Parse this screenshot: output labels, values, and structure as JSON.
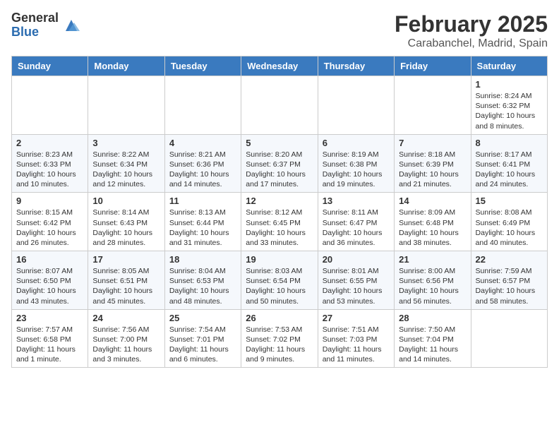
{
  "header": {
    "logo_general": "General",
    "logo_blue": "Blue",
    "month": "February 2025",
    "location": "Carabanchel, Madrid, Spain"
  },
  "days_of_week": [
    "Sunday",
    "Monday",
    "Tuesday",
    "Wednesday",
    "Thursday",
    "Friday",
    "Saturday"
  ],
  "weeks": [
    [
      {
        "day": "",
        "info": ""
      },
      {
        "day": "",
        "info": ""
      },
      {
        "day": "",
        "info": ""
      },
      {
        "day": "",
        "info": ""
      },
      {
        "day": "",
        "info": ""
      },
      {
        "day": "",
        "info": ""
      },
      {
        "day": "1",
        "info": "Sunrise: 8:24 AM\nSunset: 6:32 PM\nDaylight: 10 hours and 8 minutes."
      }
    ],
    [
      {
        "day": "2",
        "info": "Sunrise: 8:23 AM\nSunset: 6:33 PM\nDaylight: 10 hours and 10 minutes."
      },
      {
        "day": "3",
        "info": "Sunrise: 8:22 AM\nSunset: 6:34 PM\nDaylight: 10 hours and 12 minutes."
      },
      {
        "day": "4",
        "info": "Sunrise: 8:21 AM\nSunset: 6:36 PM\nDaylight: 10 hours and 14 minutes."
      },
      {
        "day": "5",
        "info": "Sunrise: 8:20 AM\nSunset: 6:37 PM\nDaylight: 10 hours and 17 minutes."
      },
      {
        "day": "6",
        "info": "Sunrise: 8:19 AM\nSunset: 6:38 PM\nDaylight: 10 hours and 19 minutes."
      },
      {
        "day": "7",
        "info": "Sunrise: 8:18 AM\nSunset: 6:39 PM\nDaylight: 10 hours and 21 minutes."
      },
      {
        "day": "8",
        "info": "Sunrise: 8:17 AM\nSunset: 6:41 PM\nDaylight: 10 hours and 24 minutes."
      }
    ],
    [
      {
        "day": "9",
        "info": "Sunrise: 8:15 AM\nSunset: 6:42 PM\nDaylight: 10 hours and 26 minutes."
      },
      {
        "day": "10",
        "info": "Sunrise: 8:14 AM\nSunset: 6:43 PM\nDaylight: 10 hours and 28 minutes."
      },
      {
        "day": "11",
        "info": "Sunrise: 8:13 AM\nSunset: 6:44 PM\nDaylight: 10 hours and 31 minutes."
      },
      {
        "day": "12",
        "info": "Sunrise: 8:12 AM\nSunset: 6:45 PM\nDaylight: 10 hours and 33 minutes."
      },
      {
        "day": "13",
        "info": "Sunrise: 8:11 AM\nSunset: 6:47 PM\nDaylight: 10 hours and 36 minutes."
      },
      {
        "day": "14",
        "info": "Sunrise: 8:09 AM\nSunset: 6:48 PM\nDaylight: 10 hours and 38 minutes."
      },
      {
        "day": "15",
        "info": "Sunrise: 8:08 AM\nSunset: 6:49 PM\nDaylight: 10 hours and 40 minutes."
      }
    ],
    [
      {
        "day": "16",
        "info": "Sunrise: 8:07 AM\nSunset: 6:50 PM\nDaylight: 10 hours and 43 minutes."
      },
      {
        "day": "17",
        "info": "Sunrise: 8:05 AM\nSunset: 6:51 PM\nDaylight: 10 hours and 45 minutes."
      },
      {
        "day": "18",
        "info": "Sunrise: 8:04 AM\nSunset: 6:53 PM\nDaylight: 10 hours and 48 minutes."
      },
      {
        "day": "19",
        "info": "Sunrise: 8:03 AM\nSunset: 6:54 PM\nDaylight: 10 hours and 50 minutes."
      },
      {
        "day": "20",
        "info": "Sunrise: 8:01 AM\nSunset: 6:55 PM\nDaylight: 10 hours and 53 minutes."
      },
      {
        "day": "21",
        "info": "Sunrise: 8:00 AM\nSunset: 6:56 PM\nDaylight: 10 hours and 56 minutes."
      },
      {
        "day": "22",
        "info": "Sunrise: 7:59 AM\nSunset: 6:57 PM\nDaylight: 10 hours and 58 minutes."
      }
    ],
    [
      {
        "day": "23",
        "info": "Sunrise: 7:57 AM\nSunset: 6:58 PM\nDaylight: 11 hours and 1 minute."
      },
      {
        "day": "24",
        "info": "Sunrise: 7:56 AM\nSunset: 7:00 PM\nDaylight: 11 hours and 3 minutes."
      },
      {
        "day": "25",
        "info": "Sunrise: 7:54 AM\nSunset: 7:01 PM\nDaylight: 11 hours and 6 minutes."
      },
      {
        "day": "26",
        "info": "Sunrise: 7:53 AM\nSunset: 7:02 PM\nDaylight: 11 hours and 9 minutes."
      },
      {
        "day": "27",
        "info": "Sunrise: 7:51 AM\nSunset: 7:03 PM\nDaylight: 11 hours and 11 minutes."
      },
      {
        "day": "28",
        "info": "Sunrise: 7:50 AM\nSunset: 7:04 PM\nDaylight: 11 hours and 14 minutes."
      },
      {
        "day": "",
        "info": ""
      }
    ]
  ]
}
